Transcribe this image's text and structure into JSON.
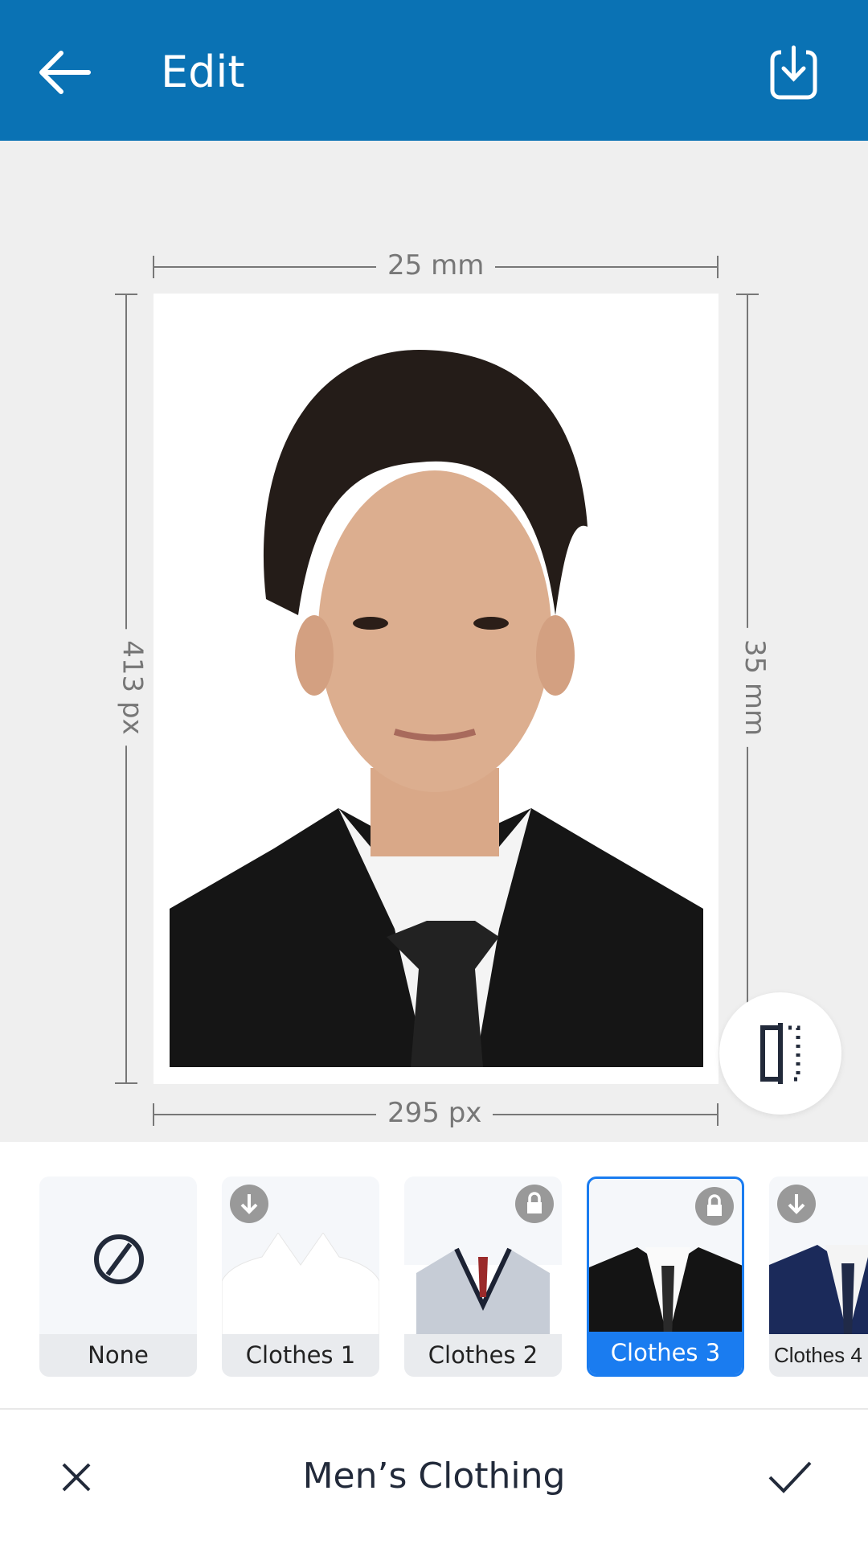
{
  "header": {
    "title": "Edit",
    "back_icon": "arrow-left-icon",
    "save_icon": "download-icon",
    "color": "#0a72b4"
  },
  "dimensions": {
    "top": "25 mm",
    "left": "413 px",
    "right": "35 mm",
    "bottom": "295 px"
  },
  "compare_icon": "compare-split-icon",
  "clothes": [
    {
      "label": "None",
      "icon": "none-icon",
      "badge": null,
      "selected": false
    },
    {
      "label": "Clothes 1",
      "badge": "download-icon",
      "selected": false
    },
    {
      "label": "Clothes 2",
      "badge": "lock-icon",
      "selected": false
    },
    {
      "label": "Clothes 3",
      "badge": "lock-icon",
      "selected": true
    },
    {
      "label": "Clothes 4",
      "badge": "download-icon",
      "selected": false
    }
  ],
  "footer": {
    "title": "Men’s Clothing",
    "cancel_icon": "close-icon",
    "confirm_icon": "check-icon"
  },
  "accent": "#1a7cf0"
}
